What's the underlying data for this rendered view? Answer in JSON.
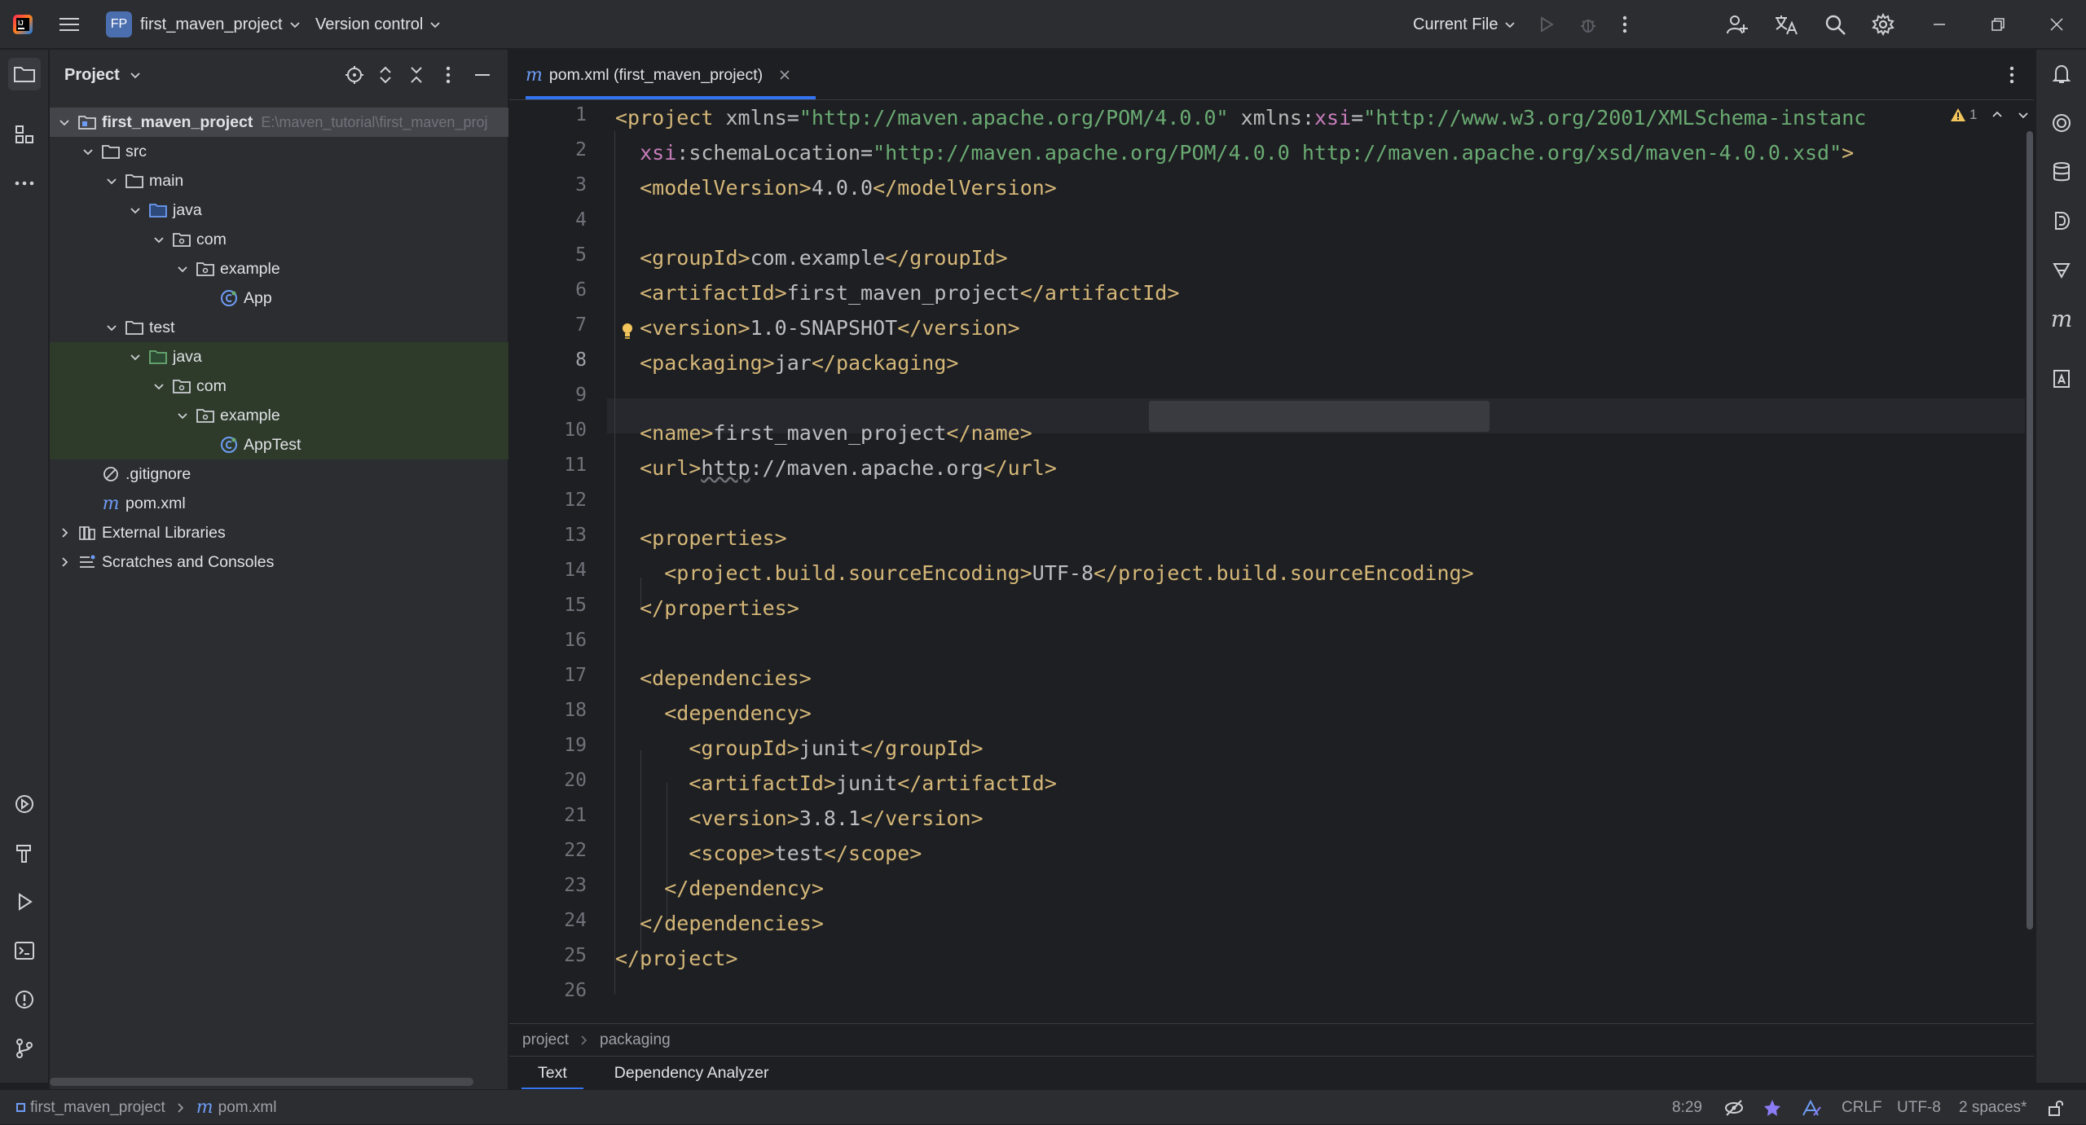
{
  "titlebar": {
    "project_badge": "FP",
    "project_name": "first_maven_project",
    "vcs": "Version control",
    "run_config": "Current File"
  },
  "project_panel": {
    "title": "Project",
    "tree": [
      {
        "label": "first_maven_project",
        "hint": "E:\\maven_tutorial\\first_maven_proj",
        "icon": "module-folder-icon"
      },
      {
        "label": "src",
        "icon": "folder-icon"
      },
      {
        "label": "main",
        "icon": "folder-icon"
      },
      {
        "label": "java",
        "icon": "source-folder-icon"
      },
      {
        "label": "com",
        "icon": "package-icon"
      },
      {
        "label": "example",
        "icon": "package-icon"
      },
      {
        "label": "App",
        "icon": "class-icon"
      },
      {
        "label": "test",
        "icon": "folder-icon"
      },
      {
        "label": "java",
        "icon": "test-folder-icon"
      },
      {
        "label": "com",
        "icon": "package-icon"
      },
      {
        "label": "example",
        "icon": "package-icon"
      },
      {
        "label": "AppTest",
        "icon": "class-icon"
      },
      {
        "label": ".gitignore",
        "icon": "ignore-file-icon"
      },
      {
        "label": "pom.xml",
        "icon": "maven-icon"
      },
      {
        "label": "External Libraries",
        "icon": "libraries-icon"
      },
      {
        "label": "Scratches and Consoles",
        "icon": "scratches-icon"
      }
    ]
  },
  "editor": {
    "tab_label": "pom.xml (first_maven_project)",
    "warning_count": "1",
    "line_numbers": [
      "1",
      "2",
      "3",
      "4",
      "5",
      "6",
      "7",
      "8",
      "9",
      "10",
      "11",
      "12",
      "13",
      "14",
      "15",
      "16",
      "17",
      "18",
      "19",
      "20",
      "21",
      "22",
      "23",
      "24",
      "25",
      "26"
    ],
    "current_line": "8",
    "breadcrumb": [
      "project",
      "packaging"
    ],
    "bottom_tabs": [
      "Text",
      "Dependency Analyzer"
    ]
  },
  "statusbar": {
    "path_project": "first_maven_project",
    "path_file": "pom.xml",
    "position": "8:29",
    "line_sep": "CRLF",
    "encoding": "UTF-8",
    "indent": "2 spaces*"
  },
  "colors": {
    "accent": "#3574f0",
    "tag": "#d5b778",
    "attr_value": "#6aab73",
    "namespace": "#c77dbb",
    "test_root_bg": "#2e3b2b"
  }
}
